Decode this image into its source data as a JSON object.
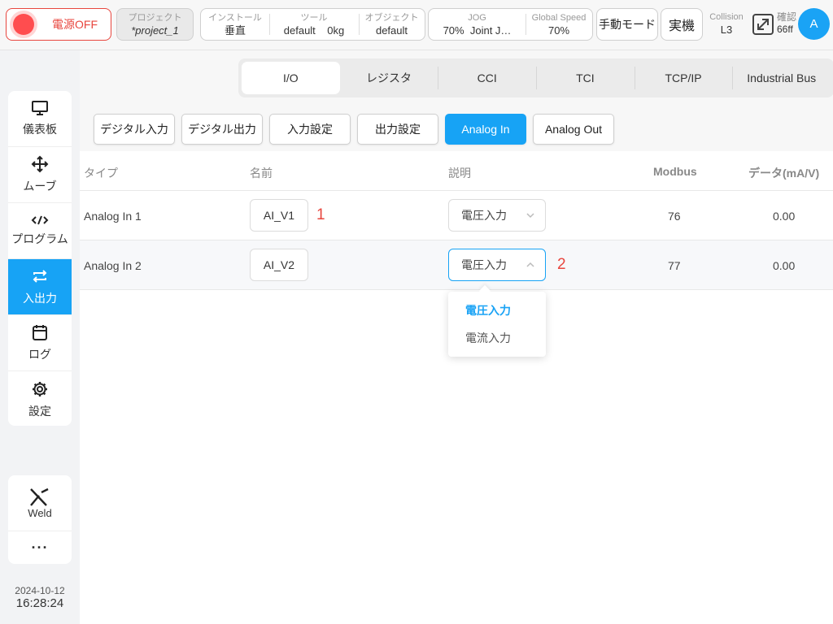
{
  "topbar": {
    "power_label": "電源OFF",
    "project_label": "プロジェクト",
    "project_value": "*project_1",
    "install_label": "インストール",
    "install_value": "垂直",
    "tool_label": "ツール",
    "tool_value_1": "default",
    "tool_value_2": "0kg",
    "object_label": "オブジェクト",
    "object_value": "default",
    "jog_label": "JOG",
    "jog_value_1": "70%",
    "jog_value_2": "Joint J…",
    "speed_label": "Global Speed",
    "speed_value": "70%",
    "mode_label": "手動モード",
    "real_label": "実機",
    "collision_label": "Collision",
    "collision_value": "L3",
    "confirm_label": "確認",
    "confirm_value": "66ff",
    "avatar_letter": "A"
  },
  "sidebar": {
    "items": [
      {
        "label": "儀表板",
        "icon": "monitor-icon"
      },
      {
        "label": "ムーブ",
        "icon": "move-icon"
      },
      {
        "label": "プログラム",
        "icon": "code-icon"
      },
      {
        "label": "入出力",
        "icon": "transfer-icon"
      },
      {
        "label": "ログ",
        "icon": "calendar-icon"
      },
      {
        "label": "設定",
        "icon": "gear-icon"
      }
    ],
    "active": "入出力",
    "weld_label": "Weld",
    "more_label": "···",
    "date": "2024-10-12",
    "time": "16:28:24"
  },
  "tabs": [
    "I/O",
    "レジスタ",
    "CCI",
    "TCI",
    "TCP/IP",
    "Industrial Bus"
  ],
  "active_tab": "I/O",
  "subtabs": [
    "デジタル入力",
    "デジタル出力",
    "入力設定",
    "出力設定",
    "Analog In",
    "Analog Out"
  ],
  "active_subtab": "Analog In",
  "table": {
    "headers": {
      "type": "タイプ",
      "name": "名前",
      "desc": "説明",
      "modbus": "Modbus",
      "data": "データ(mA/V)"
    },
    "rows": [
      {
        "type": "Analog In 1",
        "name": "AI_V1",
        "marker": "1",
        "desc": "電圧入力",
        "modbus": "76",
        "data": "0.00"
      },
      {
        "type": "Analog In 2",
        "name": "AI_V2",
        "marker": "2",
        "desc": "電圧入力",
        "modbus": "77",
        "data": "0.00"
      }
    ]
  },
  "dropdown": {
    "options": [
      "電圧入力",
      "電流入力"
    ],
    "selected": "電圧入力"
  },
  "colors": {
    "accent": "#17a3f5",
    "danger": "#e8463e"
  }
}
